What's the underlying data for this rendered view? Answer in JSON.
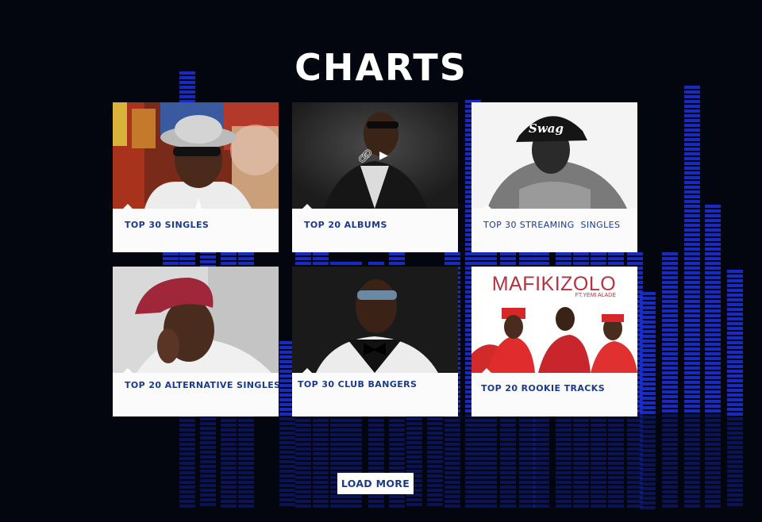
{
  "page": {
    "title": "CHARTS",
    "load_more_label": "LOAD MORE"
  },
  "cards": [
    {
      "label": "TOP 30 SINGLES",
      "thumb": "wizkid-white-hat-photo"
    },
    {
      "label": "TOP 20 ALBUMS",
      "thumb": "artist-sunglasses-suit-photo",
      "overlay_icons": [
        "link-icon",
        "play-icon"
      ]
    },
    {
      "label": "TOP 30 STREAMING  SINGLES",
      "thumb": "davido-swag-cap-photo",
      "cap_text": "Swag"
    },
    {
      "label": "TOP 20 ALTERNATIVE SINGLES",
      "thumb": "adekunle-red-beret-photo"
    },
    {
      "label": "TOP 30 CLUB BANGERS",
      "thumb": "olamide-bowtie-photo"
    },
    {
      "label": "TOP 20 ROOKIE TRACKS",
      "thumb": "mafikizolo-cover-art",
      "cover_title": "MAFIKIZOLO",
      "cover_subtitle": "FT.YEMI ALADE"
    }
  ],
  "colors": {
    "background": "#03060f",
    "equalizer": "#1a2fd6",
    "label": "#1b3a8a",
    "card": "#fbfbfc"
  }
}
